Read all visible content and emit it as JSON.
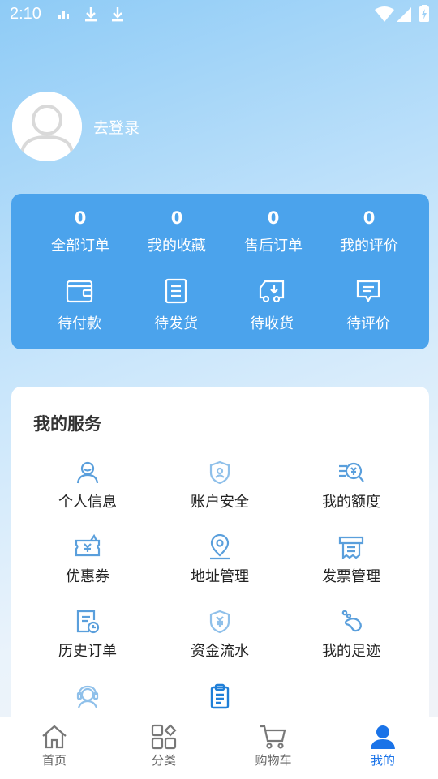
{
  "status_bar": {
    "time": "2:10"
  },
  "profile": {
    "login_label": "去登录"
  },
  "stats": [
    {
      "value": "0",
      "label": "全部订单"
    },
    {
      "value": "0",
      "label": "我的收藏"
    },
    {
      "value": "0",
      "label": "售后订单"
    },
    {
      "value": "0",
      "label": "我的评价"
    }
  ],
  "order_status": [
    {
      "label": "待付款",
      "icon": "wallet-icon"
    },
    {
      "label": "待发货",
      "icon": "document-icon"
    },
    {
      "label": "待收货",
      "icon": "truck-icon"
    },
    {
      "label": "待评价",
      "icon": "comment-icon"
    }
  ],
  "services": {
    "title": "我的服务",
    "items": [
      {
        "label": "个人信息",
        "icon": "user-icon"
      },
      {
        "label": "账户安全",
        "icon": "shield-icon"
      },
      {
        "label": "我的额度",
        "icon": "quota-search-icon"
      },
      {
        "label": "优惠券",
        "icon": "coupon-icon"
      },
      {
        "label": "地址管理",
        "icon": "location-pin-icon"
      },
      {
        "label": "发票管理",
        "icon": "invoice-icon"
      },
      {
        "label": "历史订单",
        "icon": "history-order-icon"
      },
      {
        "label": "资金流水",
        "icon": "money-shield-icon"
      },
      {
        "label": "我的足迹",
        "icon": "footprint-icon"
      },
      {
        "label": "",
        "icon": "customer-service-icon"
      },
      {
        "label": "",
        "icon": "clipboard-icon"
      }
    ]
  },
  "tabbar": {
    "active": "我的",
    "items": [
      {
        "label": "首页",
        "icon": "home-icon"
      },
      {
        "label": "分类",
        "icon": "category-icon"
      },
      {
        "label": "购物车",
        "icon": "cart-icon"
      },
      {
        "label": "我的",
        "icon": "profile-icon"
      }
    ]
  },
  "colors": {
    "accent": "#4ba3ec",
    "tab_active": "#1a73e8",
    "service_icon": "#5a9fdc"
  }
}
